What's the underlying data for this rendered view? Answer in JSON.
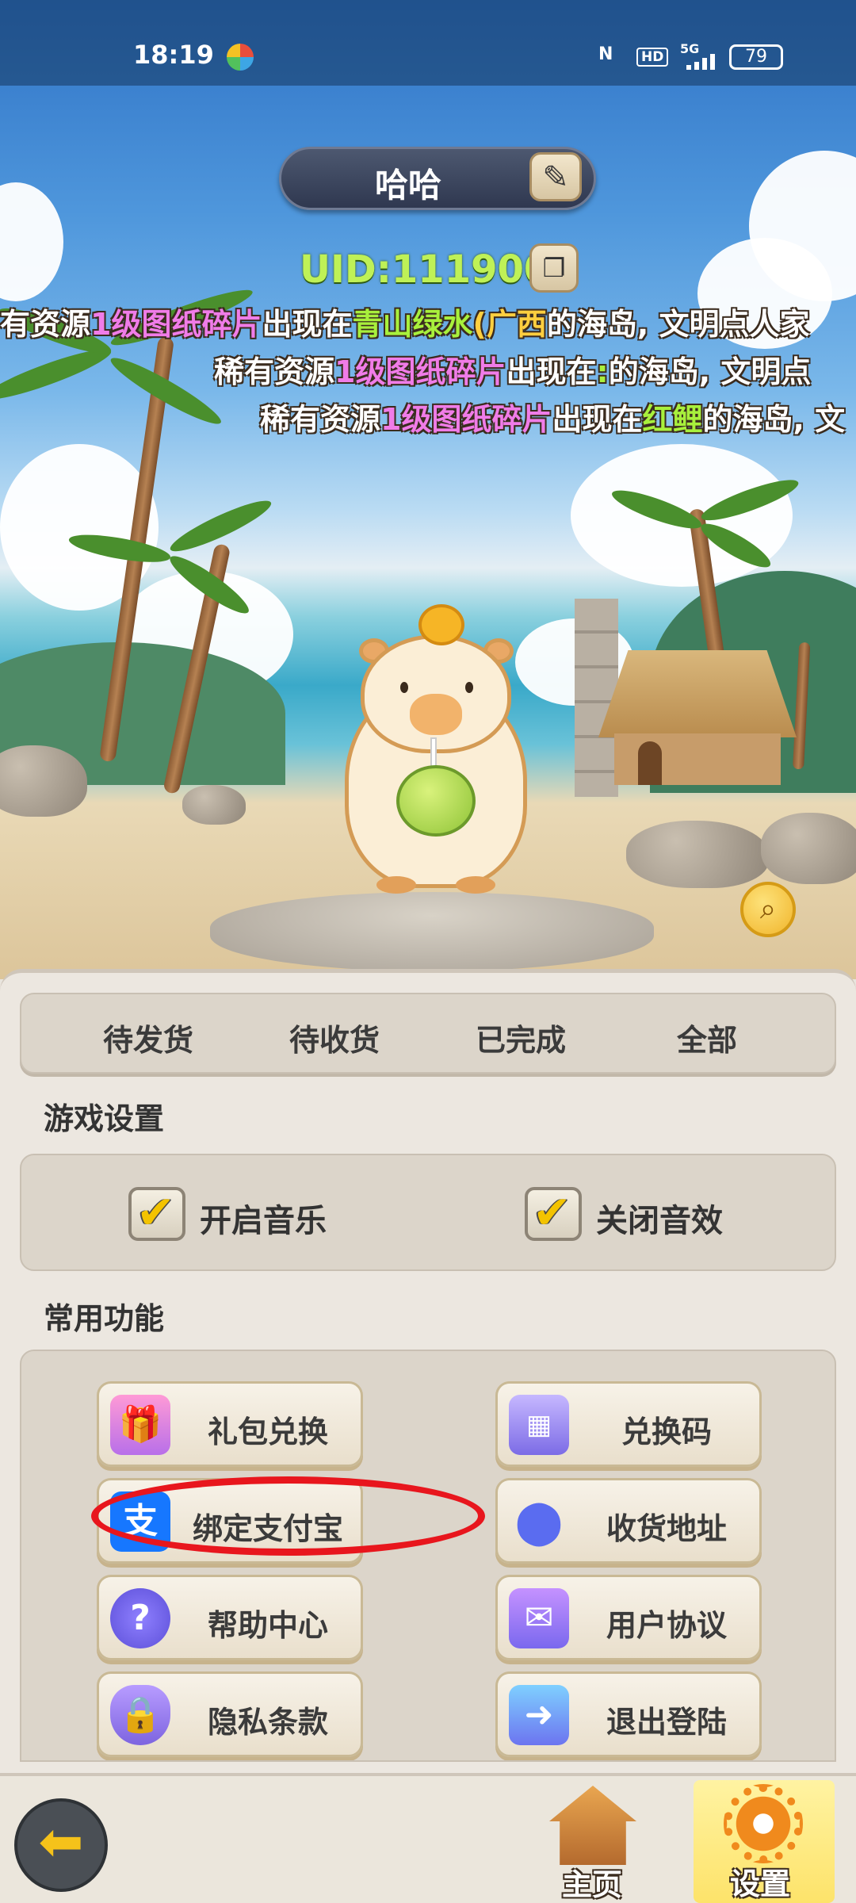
{
  "status_bar": {
    "time": "18:19",
    "nfc": "N",
    "hd": "HD",
    "network": "5G",
    "battery": "79"
  },
  "profile": {
    "name": "哈哈",
    "uid_label": "UID",
    "uid_sep": ":",
    "uid_value": "111900"
  },
  "ticker": [
    {
      "a": "有资源",
      "b": "1级图纸碎片",
      "c": "出现在",
      "d": "青山绿水",
      "e": "(",
      "f": "广西",
      "g": "的海岛, 文明点人家"
    },
    {
      "a": "稀有资源",
      "b": "1级图纸碎片",
      "c": "出现在",
      "d": ":",
      "e": "",
      "f": "",
      "g": "的海岛, 文明点"
    },
    {
      "a": "稀有资源",
      "b": "1级图纸碎片",
      "c": "出现在",
      "d": "红鲤",
      "e": "",
      "f": "",
      "g": "的海岛, 文"
    }
  ],
  "order_tabs": [
    "待发货",
    "待收货",
    "已完成",
    "全部"
  ],
  "game_settings": {
    "title": "游戏设置",
    "music_label": "开启音乐",
    "sound_label": "关闭音效"
  },
  "functions": {
    "title": "常用功能",
    "items": [
      {
        "label": "礼包兑换",
        "icon": "gift-icon"
      },
      {
        "label": "兑换码",
        "icon": "calculator-icon"
      },
      {
        "label": "绑定支付宝",
        "icon": "alipay-icon"
      },
      {
        "label": "收货地址",
        "icon": "location-pin-icon"
      },
      {
        "label": "帮助中心",
        "icon": "help-gear-icon"
      },
      {
        "label": "用户协议",
        "icon": "mail-icon"
      },
      {
        "label": "隐私条款",
        "icon": "shield-lock-icon"
      },
      {
        "label": "退出登陆",
        "icon": "exit-door-icon"
      }
    ]
  },
  "bottom_nav": {
    "home": "主页",
    "settings": "设置"
  },
  "colors": {
    "highlight_pink": "#f07ce8",
    "highlight_green": "#a8f03c",
    "highlight_orange": "#ffcf3f",
    "uid_green": "#bff157",
    "annotation_red": "#e8161d",
    "active_tab_yellow": "#fde36a"
  }
}
